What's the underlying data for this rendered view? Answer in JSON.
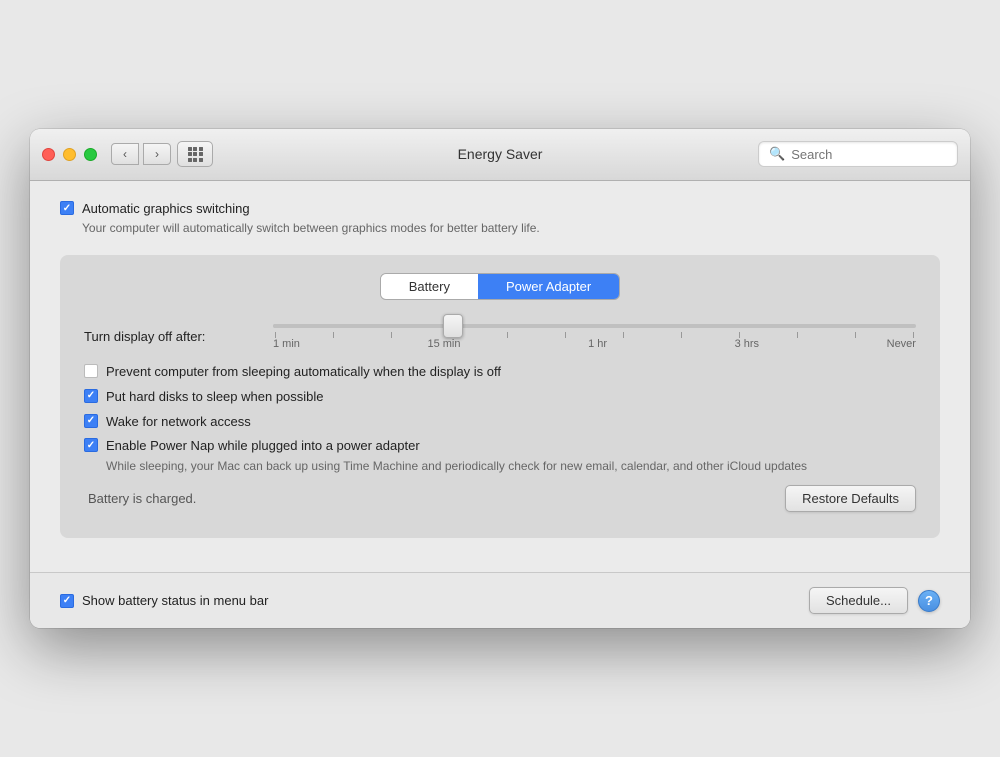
{
  "window": {
    "title": "Energy Saver"
  },
  "header": {
    "search_placeholder": "Search"
  },
  "top_section": {
    "auto_graphics_label": "Automatic graphics switching",
    "auto_graphics_sublabel": "Your computer will automatically switch between graphics modes for better battery life.",
    "auto_graphics_checked": true
  },
  "tabs": {
    "battery_label": "Battery",
    "power_adapter_label": "Power Adapter",
    "active_tab": "power_adapter"
  },
  "slider": {
    "label": "Turn display off after:",
    "tick_labels": [
      "1 min",
      "15 min",
      "1 hr",
      "3 hrs",
      "Never"
    ]
  },
  "checkboxes": [
    {
      "id": "prevent_sleep",
      "label": "Prevent computer from sleeping automatically when the display is off",
      "checked": false
    },
    {
      "id": "hard_disks",
      "label": "Put hard disks to sleep when possible",
      "checked": true
    },
    {
      "id": "wake_network",
      "label": "Wake for network access",
      "checked": true
    },
    {
      "id": "power_nap",
      "label": "Enable Power Nap while plugged into a power adapter",
      "sublabel": "While sleeping, your Mac can back up using Time Machine and periodically check for new email, calendar, and other iCloud updates",
      "checked": true
    }
  ],
  "bottom": {
    "battery_status": "Battery is charged.",
    "restore_button": "Restore Defaults"
  },
  "footer": {
    "show_battery_label": "Show battery status in menu bar",
    "show_battery_checked": true,
    "schedule_button": "Schedule...",
    "help_button": "?"
  }
}
